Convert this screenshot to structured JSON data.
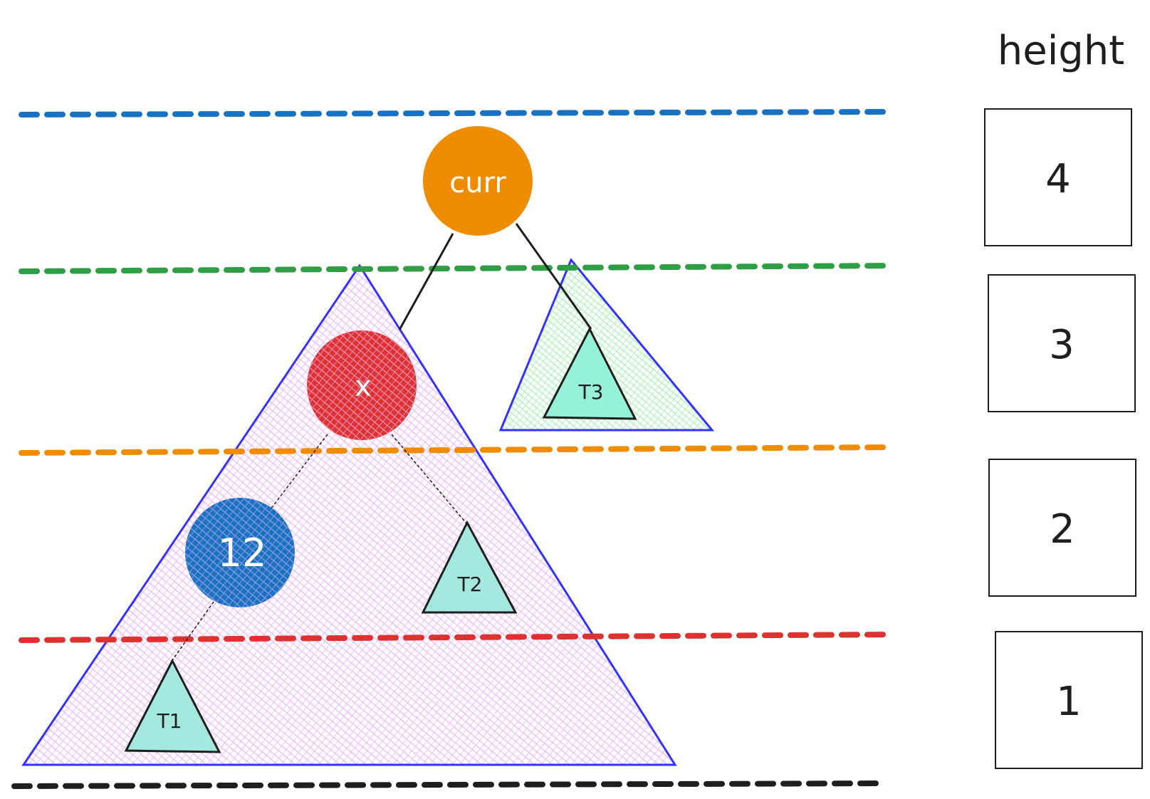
{
  "title": "height",
  "levels": [
    {
      "height": "4",
      "color": "#1971c2"
    },
    {
      "height": "3",
      "color": "#2f9e44"
    },
    {
      "height": "2",
      "color": "#f08c00"
    },
    {
      "height": "1",
      "color": "#e03131"
    },
    {
      "height": "",
      "color": "#1e1e1e"
    }
  ],
  "nodes": {
    "curr": {
      "label": "curr",
      "color": "#f08c00"
    },
    "x": {
      "label": "x",
      "color": "#e03131"
    },
    "blue": {
      "label": "12",
      "color": "#1971c2"
    }
  },
  "subtrees": {
    "t1": {
      "label": "T1",
      "color": "#96f2d7"
    },
    "t2": {
      "label": "T2",
      "color": "#96f2d7"
    },
    "t3": {
      "label": "T3",
      "color": "#96f2d7"
    },
    "big": {
      "color": "#eebefa",
      "stroke": "#3333ff"
    }
  }
}
